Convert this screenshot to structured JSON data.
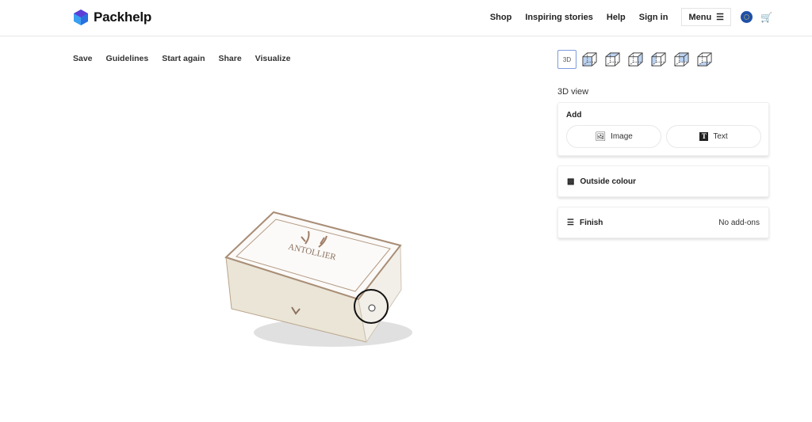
{
  "header": {
    "brand": "Packhelp",
    "nav": [
      "Shop",
      "Inspiring stories",
      "Help",
      "Sign in"
    ],
    "menu_label": "Menu",
    "brand_color": "#4b3cd6"
  },
  "toolbar": [
    "Save",
    "Guidelines",
    "Start again",
    "Share",
    "Visualize"
  ],
  "views": {
    "label_3d": "3D",
    "icons": [
      "cube-front-icon",
      "cube-top-icon",
      "cube-right-icon",
      "cube-left-icon",
      "cube-back-icon",
      "cube-bottom-icon"
    ],
    "accent": "#7f9be0"
  },
  "panel": {
    "title": "3D view",
    "add": {
      "title": "Add",
      "image": "Image",
      "text": "Text"
    },
    "outside_colour": "Outside colour",
    "finish": {
      "label": "Finish",
      "value": "No add-ons"
    }
  },
  "product": {
    "logo_text": "ANTOLLIER"
  }
}
